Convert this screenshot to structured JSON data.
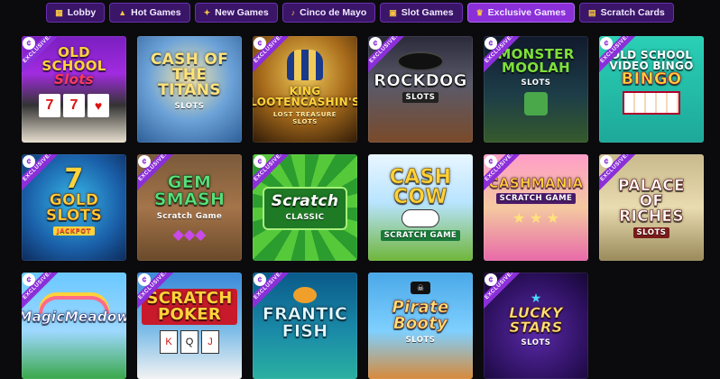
{
  "nav": {
    "tabs": [
      {
        "label": "Lobby",
        "icon": "grid-icon",
        "glyph": "▦",
        "active": false
      },
      {
        "label": "Hot Games",
        "icon": "flame-icon",
        "glyph": "🔥",
        "active": false
      },
      {
        "label": "New Games",
        "icon": "sparkle-icon",
        "glyph": "✦",
        "active": false
      },
      {
        "label": "Cinco de Mayo",
        "icon": "maracas-icon",
        "glyph": "♪",
        "active": false
      },
      {
        "label": "Slot Games",
        "icon": "slot-machine-icon",
        "glyph": "▣",
        "active": false
      },
      {
        "label": "Exclusive Games",
        "icon": "crown-icon",
        "glyph": "♛",
        "active": true
      },
      {
        "label": "Scratch Cards",
        "icon": "scratch-card-icon",
        "glyph": "▤",
        "active": false
      }
    ]
  },
  "ribbon_text": "EXCLUSIVE!",
  "badge_glyph": "¢",
  "games": [
    {
      "title": "OLD SCHOOL",
      "subtitle": "Slots",
      "title_color": "#ffd23a",
      "sub_color": "#ff3a5a"
    },
    {
      "title": "CASH OF THE TITANS",
      "subtitle": "SLOTS",
      "title_color": "#ffe27a",
      "sub_color": "#ffffff"
    },
    {
      "title": "KING LOOTENCASHIN'S",
      "subtitle": "LOST TREASURE SLOTS",
      "title_color": "#ffd23a",
      "sub_color": "#ffe9a0"
    },
    {
      "title": "ROCKDOG",
      "subtitle": "SLOTS",
      "title_color": "#ffffff",
      "sub_color": "#ffffff"
    },
    {
      "title": "MONSTER MOOLAH",
      "subtitle": "SLOTS",
      "title_color": "#7fe03a",
      "sub_color": "#ffffff"
    },
    {
      "title": "OLD SCHOOL VIDEO BINGO",
      "subtitle": "BINGO",
      "title_color": "#ffffff",
      "sub_color": "#ffd23a"
    },
    {
      "title": "GOLD SLOTS",
      "subtitle": "JACKPOT",
      "title_color": "#ffd23a",
      "sub_color": "#ff5a3a"
    },
    {
      "title": "GEM SMASH",
      "subtitle": "Scratch Game",
      "title_color": "#5adf7a",
      "sub_color": "#ffffff"
    },
    {
      "title": "Scratch",
      "subtitle": "CLASSIC",
      "title_color": "#ffffff",
      "sub_color": "#ffffff"
    },
    {
      "title": "CASH COW",
      "subtitle": "SCRATCH GAME",
      "title_color": "#ffd23a",
      "sub_color": "#1a7a3a"
    },
    {
      "title": "CASHMANIA",
      "subtitle": "SCRATCH GAME",
      "title_color": "#ffd23a",
      "sub_color": "#ffffff"
    },
    {
      "title": "PALACE OF RICHES",
      "subtitle": "SLOTS",
      "title_color": "#ffffff",
      "sub_color": "#ffffff"
    },
    {
      "title": "MagicMeadow",
      "subtitle": "",
      "title_color": "#ffffff",
      "sub_color": "#ffffff"
    },
    {
      "title": "SCRATCH POKER",
      "subtitle": "",
      "title_color": "#ffd23a",
      "sub_color": "#ffffff"
    },
    {
      "title": "FRANTIC FISH",
      "subtitle": "",
      "title_color": "#e8fbff",
      "sub_color": "#ffffff"
    },
    {
      "title": "Pirate Booty",
      "subtitle": "SLOTS",
      "title_color": "#ffe27a",
      "sub_color": "#ffffff"
    },
    {
      "title": "LUCKY STARS",
      "subtitle": "SLOTS",
      "title_color": "#ffe27a",
      "sub_color": "#ffffff"
    }
  ]
}
